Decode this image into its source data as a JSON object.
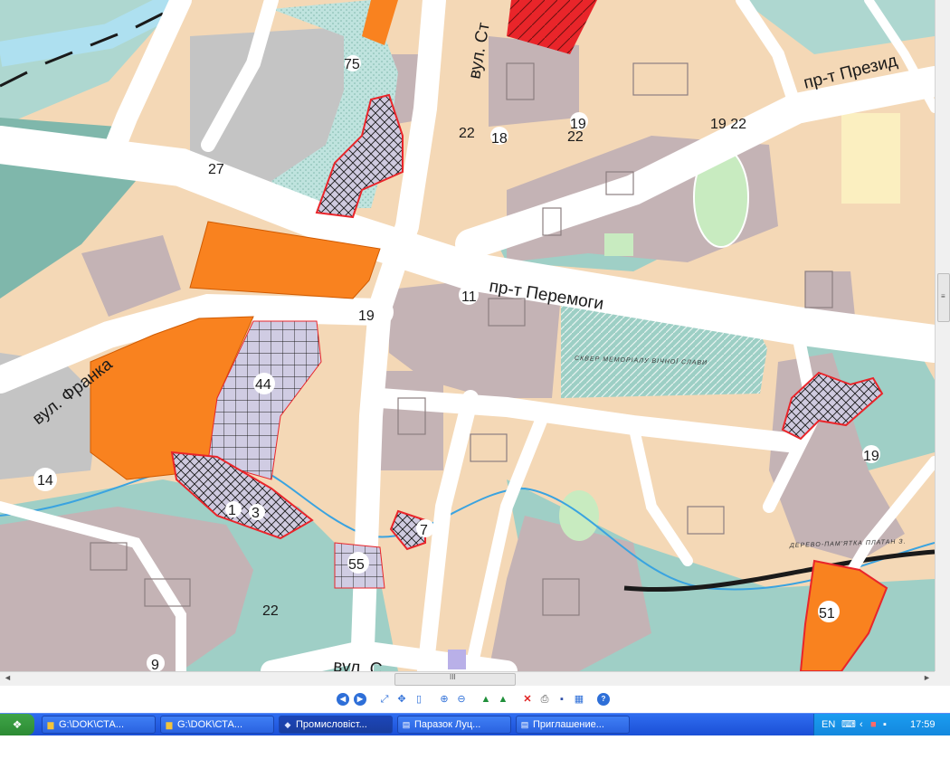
{
  "map": {
    "streets": {
      "peremohy": "пр-т Перемоги",
      "franka": "вул. Франка",
      "prezydenta": "пр-т Презид",
      "st": "вул. Ст",
      "bottom": "вул. С"
    },
    "square_label": "СКВЕР МЕМОРІАЛУ ВІЧНОЇ СЛАВИ",
    "platan_label": "ДЕРЕВО-ПАМ'ЯТКА ПЛАТАН З.",
    "numbers": {
      "n75": "75",
      "n27": "27",
      "n22a": "22",
      "n18": "18",
      "n19a": "19",
      "n22b": "22",
      "n19_22": "19 22",
      "n11": "11",
      "n19b": "19",
      "n44": "44",
      "n14": "14",
      "n1": "1",
      "n3": "3",
      "n7": "7",
      "n55": "55",
      "n22c": "22",
      "n9": "9",
      "n19c": "19",
      "n51": "51"
    },
    "colors": {
      "land": "#f4d8b6",
      "block": "#c4b3b5",
      "green": "#aed7d0",
      "teal": "#7fb7ab",
      "road": "#ffffff",
      "orange": "#f9821f",
      "red": "#e9252a",
      "hatched": "#cfcadf",
      "river": "#3aa3e0"
    }
  },
  "scrollbars": {
    "h_grip": "III",
    "v_grip": "≡",
    "left_arrow": "◄",
    "right_arrow": "►"
  },
  "toolbar": {
    "icons": [
      "first-icon",
      "prev-icon",
      "zoom-extent-icon",
      "pan-icon",
      "select-icon",
      "zoom-in-icon",
      "zoom-out-icon",
      "measure-up-icon",
      "measure-down-icon",
      "delete-icon",
      "print-icon",
      "save-icon",
      "layers-icon",
      "help-icon"
    ]
  },
  "taskbar": {
    "start_glyph": "❖",
    "tasks": [
      {
        "label": "G:\\DOK\\СТА...",
        "icon": "folder-icon",
        "glyph": "▆"
      },
      {
        "label": "G:\\DOK\\СТА...",
        "icon": "folder-icon",
        "glyph": "▆"
      },
      {
        "label": "Промисловіст...",
        "icon": "map-app-icon",
        "glyph": "◆"
      },
      {
        "label": "Паразок Луц...",
        "icon": "document-icon",
        "glyph": "▤"
      },
      {
        "label": "Приглашение...",
        "icon": "document-icon",
        "glyph": "▤"
      }
    ],
    "tray": {
      "language": "EN",
      "clock": "17:59"
    }
  }
}
